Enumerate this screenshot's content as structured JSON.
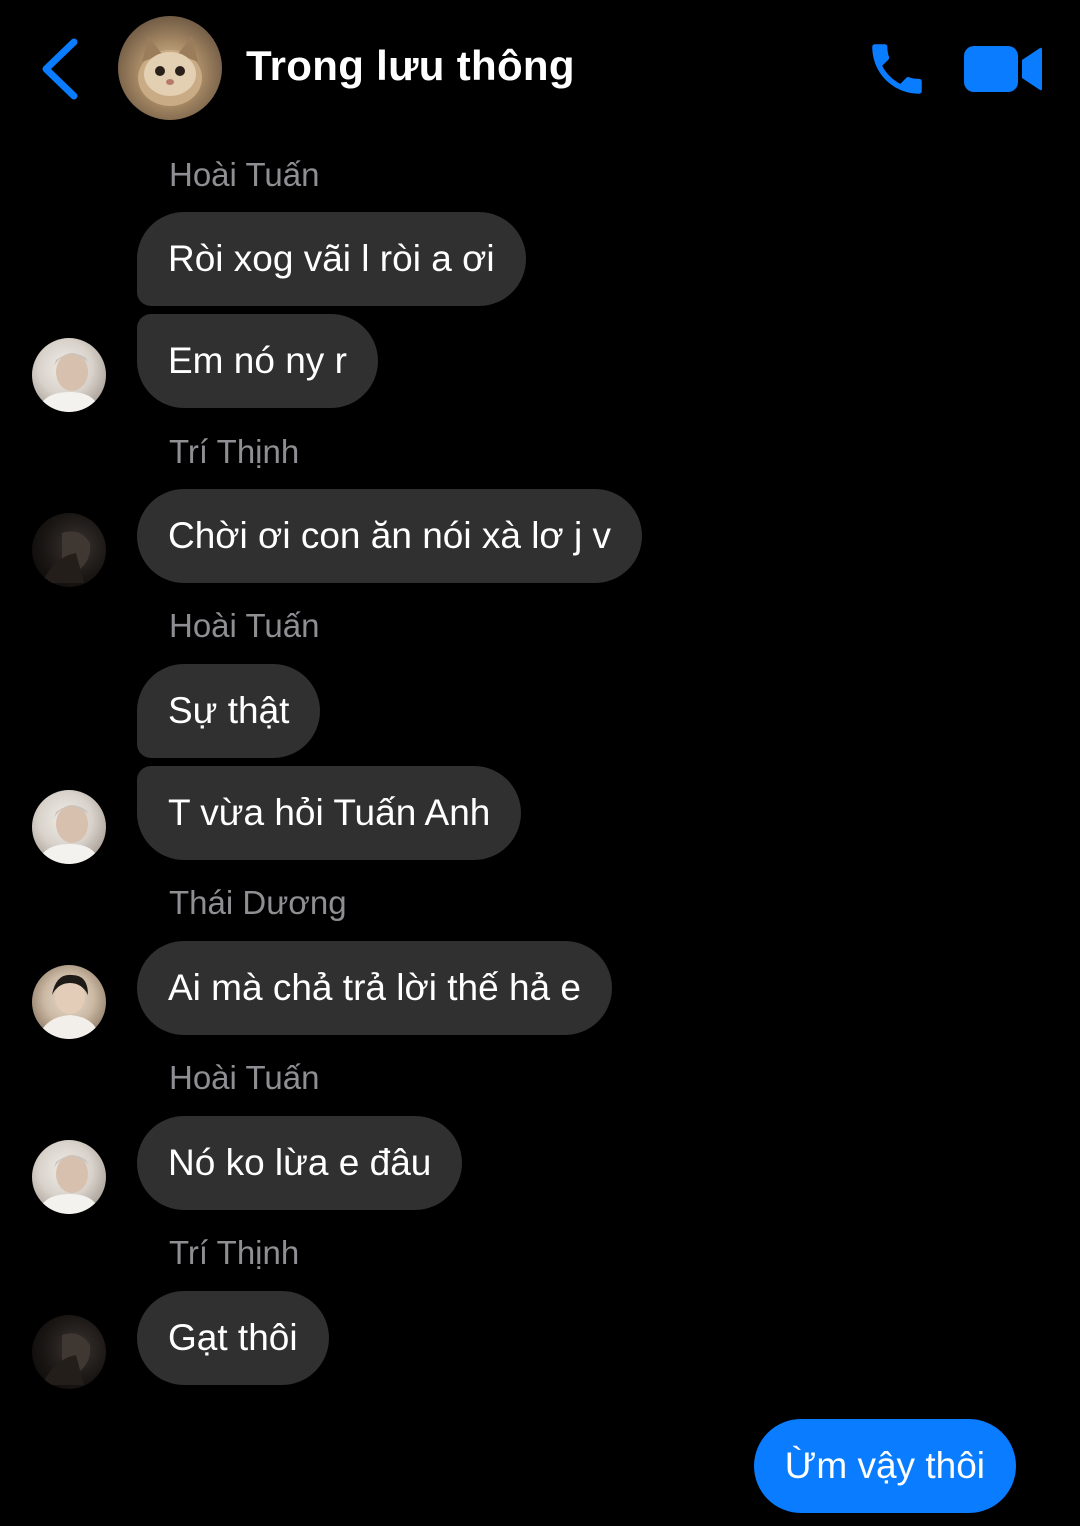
{
  "header": {
    "title": "Trong lưu thông",
    "accent_color": "#0a7cff",
    "back_icon": "chevron-left-icon",
    "call_icon": "phone-icon",
    "video_icon": "video-camera-icon"
  },
  "messages": [
    {
      "sender": "Hoài Tuấn",
      "text": "Ròi xog vãi l ròi a ơi"
    },
    {
      "text": "Em nó ny r"
    },
    {
      "sender": "Trí Thịnh",
      "text": "Chời ơi con ăn nói xà lơ j v"
    },
    {
      "sender": "Hoài Tuấn",
      "text": "Sự thật"
    },
    {
      "text": "T vừa hỏi Tuấn Anh"
    },
    {
      "sender": "Thái Dương",
      "text": "Ai mà chả trả lời thế hả e"
    },
    {
      "sender": "Hoài Tuấn",
      "text": "Nó ko lừa e đâu"
    },
    {
      "sender": "Trí Thịnh",
      "text": "Gạt thôi"
    },
    {
      "text": "Ừm vậy thôi",
      "outgoing": true
    }
  ],
  "colors": {
    "background": "#000000",
    "incoming_bubble": "#303030",
    "outgoing_bubble": "#0a7cff",
    "sender_name": "#8e8e93"
  }
}
